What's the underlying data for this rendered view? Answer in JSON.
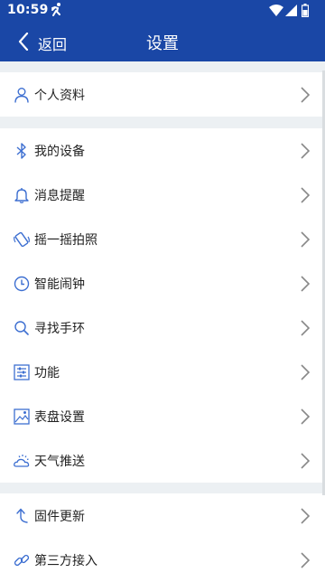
{
  "status": {
    "time": "10:59"
  },
  "header": {
    "back_label": "返回",
    "title": "设置"
  },
  "sections": [
    {
      "items": [
        {
          "label": "个人资料",
          "icon": "person-icon"
        }
      ]
    },
    {
      "items": [
        {
          "label": "我的设备",
          "icon": "bluetooth-icon"
        },
        {
          "label": "消息提醒",
          "icon": "bell-icon"
        },
        {
          "label": "摇一摇拍照",
          "icon": "shake-photo-icon"
        },
        {
          "label": "智能闹钟",
          "icon": "alarm-clock-icon"
        },
        {
          "label": "寻找手环",
          "icon": "search-icon"
        },
        {
          "label": "功能",
          "icon": "sliders-icon"
        },
        {
          "label": "表盘设置",
          "icon": "watchface-icon"
        },
        {
          "label": "天气推送",
          "icon": "weather-icon"
        }
      ]
    },
    {
      "items": [
        {
          "label": "固件更新",
          "icon": "firmware-update-icon"
        },
        {
          "label": "第三方接入",
          "icon": "link-icon"
        }
      ]
    }
  ],
  "colors": {
    "primary": "#1a47a6",
    "icon_blue": "#3d6fd1",
    "background": "#ecf0f3"
  }
}
